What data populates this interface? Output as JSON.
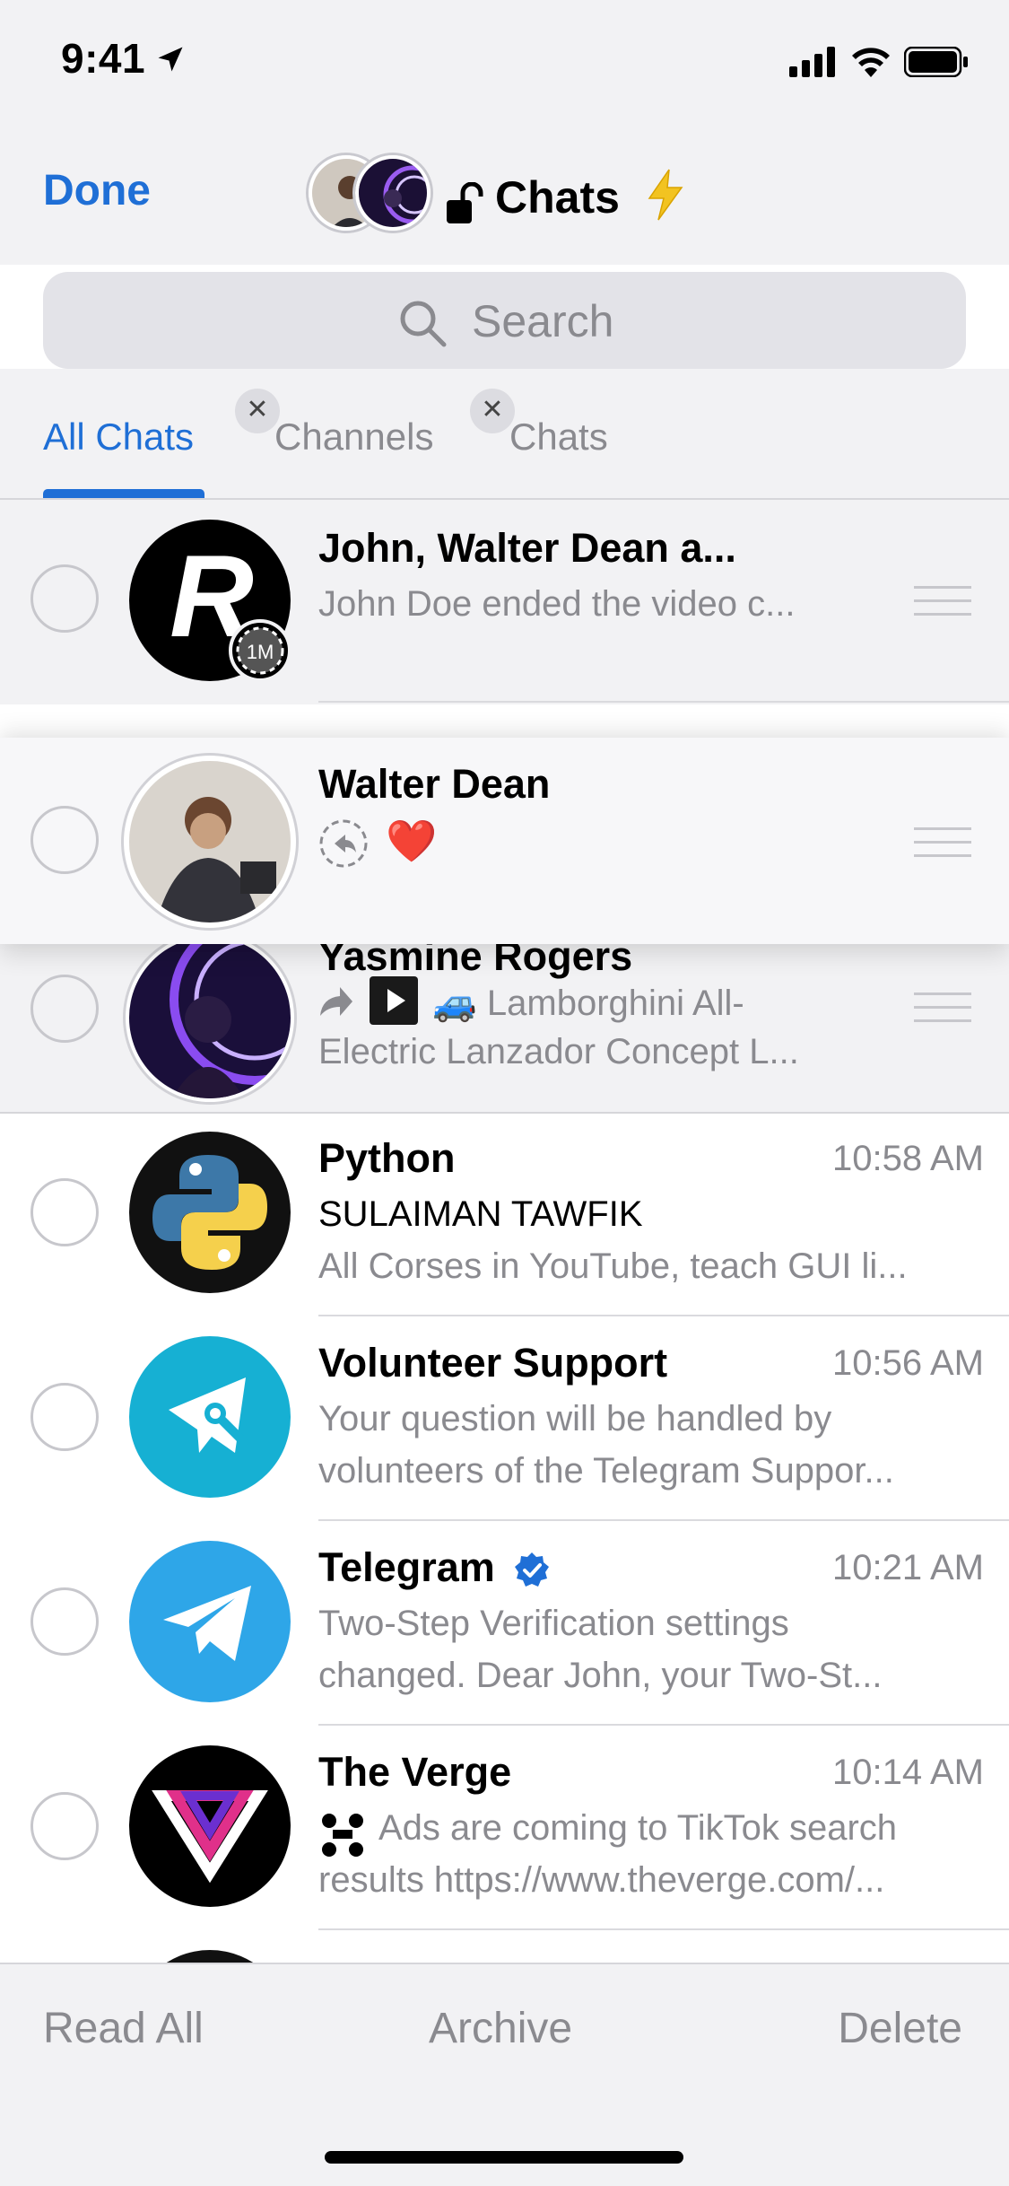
{
  "status_bar": {
    "time": "9:41"
  },
  "nav": {
    "done_label": "Done",
    "title": "Chats"
  },
  "search": {
    "placeholder": "Search"
  },
  "tabs": [
    {
      "label": "All Chats",
      "active": true
    },
    {
      "label": "Channels",
      "removable": true
    },
    {
      "label": "Chats",
      "removable": true
    }
  ],
  "chats": [
    {
      "name": "John, Walter Dean a...",
      "line1": "John Doe ended the video c...",
      "badge": "1M",
      "pinned": true
    },
    {
      "name": "Walter Dean",
      "line1": "❤️",
      "pinned": true,
      "lifted": true
    },
    {
      "name": "Yasmine Rogers",
      "line1": "🚙 Lamborghini All-",
      "line2": "Electric Lanzador Concept L...",
      "pinned": true
    },
    {
      "name": "Python",
      "time": "10:58 AM",
      "sender": "SULAIMAN TAWFIK",
      "line1": "All Corses in YouTube, teach GUI li..."
    },
    {
      "name": "Volunteer Support",
      "time": "10:56 AM",
      "line1": "Your question will be handled by",
      "line2": "volunteers of the Telegram Suppor..."
    },
    {
      "name": "Telegram",
      "time": "10:21 AM",
      "verified": true,
      "line1": "Two-Step Verification settings",
      "line2": "changed. Dear John, your Two-St..."
    },
    {
      "name": "The Verge",
      "time": "10:14 AM",
      "line1": "Ads are coming to TikTok search",
      "line2": "results https://www.theverge.com/..."
    }
  ],
  "toolbar": {
    "read_all": "Read All",
    "archive": "Archive",
    "delete": "Delete"
  },
  "colors": {
    "accent": "#1f6fd6",
    "secondary_text": "#8a8a8f",
    "background": "#f2f2f4"
  }
}
